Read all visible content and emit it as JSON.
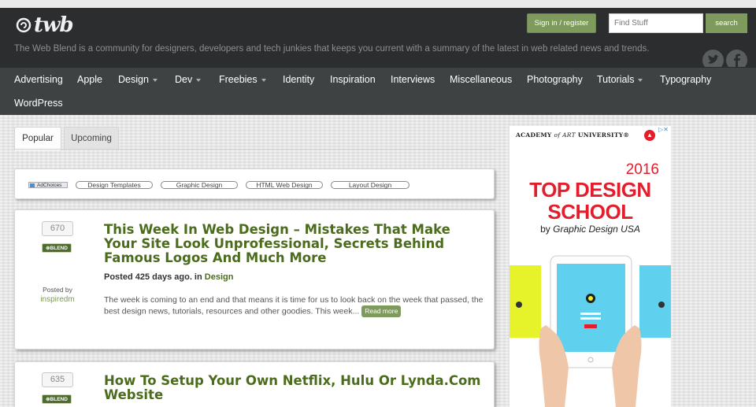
{
  "header": {
    "logo_text": "twb",
    "tagline": "The Web Blend is a community for designers, developers and tech junkies that keeps you current with a summary of the latest in web related news and trends.",
    "signin_label": "Sign in / register",
    "search_placeholder": "Find Stuff",
    "search_button": "search"
  },
  "nav": [
    {
      "label": "Advertising",
      "dropdown": false
    },
    {
      "label": "Apple",
      "dropdown": false
    },
    {
      "label": "Design",
      "dropdown": true
    },
    {
      "label": "Dev",
      "dropdown": true
    },
    {
      "label": "Freebies",
      "dropdown": true
    },
    {
      "label": "Identity",
      "dropdown": false
    },
    {
      "label": "Inspiration",
      "dropdown": false
    },
    {
      "label": "Interviews",
      "dropdown": false
    },
    {
      "label": "Miscellaneous",
      "dropdown": false
    },
    {
      "label": "Photography",
      "dropdown": false
    },
    {
      "label": "Tutorials",
      "dropdown": true
    },
    {
      "label": "Typography",
      "dropdown": false
    },
    {
      "label": "WordPress",
      "dropdown": false
    }
  ],
  "tabs": {
    "popular": "Popular",
    "upcoming": "Upcoming"
  },
  "ad_links": {
    "adchoices": "AdChoices",
    "links": [
      "Design Templates",
      "Graphic Design",
      "HTML Web Design",
      "Layout Design"
    ]
  },
  "posts": [
    {
      "votes": "670",
      "badge": "BLEND",
      "posted_by": "Posted by",
      "author": "inspiredm",
      "title": "This Week In Web Design – Mistakes That Make Your Site Look Unprofessional, Secrets Behind Famous Logos And Much More",
      "meta_prefix": "Posted 425 days ago. in ",
      "category": "Design",
      "excerpt": "The week is coming to an end and that means it is time for us to look back on the week that passed, the best design news, tutorials, resources and other goodies. This week...",
      "read_more": "Read more"
    },
    {
      "votes": "635",
      "badge": "BLEND",
      "title": "How To Setup Your Own Netflix, Hulu Or Lynda.Com Website"
    }
  ],
  "sidebar_ad": {
    "brand_academy": "ACADEMY",
    "brand_of_art": "of ART",
    "brand_university": "UNIVERSITY",
    "tm": "®",
    "year": "2016",
    "headline_line1": "TOP DESIGN",
    "headline_line2": "SCHOOL",
    "by_prefix": "by ",
    "by_name": "Graphic Design USA",
    "colors": {
      "accent": "#e41d2c",
      "tablet_screen": "#5fd0ee",
      "yellow": "#e6f32a"
    }
  },
  "colors": {
    "brand_green": "#7e9a5c",
    "title_green": "#4b6b1d",
    "header_bg": "#2b2d2e",
    "nav_bg": "#3e4243"
  }
}
